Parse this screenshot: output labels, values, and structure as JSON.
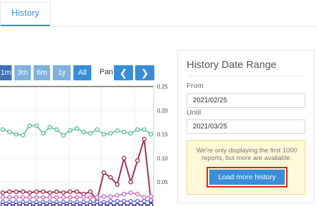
{
  "tabs": [
    {
      "label": "History"
    }
  ],
  "toolbar": {
    "range_buttons": [
      "1m",
      "3m",
      "6m",
      "1y",
      "All"
    ],
    "pan_label": "Pan",
    "prev_icon": "chevron-left-icon",
    "next_icon": "chevron-right-icon"
  },
  "panel": {
    "title": "History Date Range",
    "from_label": "From",
    "from_value": "2021/02/25",
    "until_label": "Until",
    "until_value": "2021/03/25",
    "notice": "We're only displaying the first 1000 reports, but more are available.",
    "load_more_label": "Load more history"
  },
  "colors": {
    "accent": "#3a8ed8",
    "highlight_border": "#e0201a",
    "series_green": "#5fbf9b",
    "series_maroon": "#9b2f5b"
  },
  "chart_data": {
    "type": "line",
    "yticks": [
      "0.25",
      "0.20",
      "0.15",
      "0.10",
      "0.05"
    ],
    "ylim": [
      0,
      0.25
    ],
    "grid": true,
    "series": [
      {
        "color": "#5fbf9b",
        "values": [
          0.16,
          0.155,
          0.15,
          0.148,
          0.168,
          0.168,
          0.152,
          0.165,
          0.16,
          0.148,
          0.158,
          0.162,
          0.155,
          0.152,
          0.16,
          0.15,
          0.152,
          0.158,
          0.155,
          0.152,
          0.16,
          0.16,
          0.15
        ]
      },
      {
        "color": "#9b2f5b",
        "values": [
          0.028,
          0.03,
          0.03,
          0.03,
          0.028,
          0.03,
          0.03,
          0.028,
          0.03,
          0.028,
          0.03,
          0.03,
          0.025,
          0.03,
          0.012,
          0.07,
          0.06,
          0.045,
          0.1,
          0.05,
          0.095,
          0.14,
          0.01
        ]
      },
      {
        "color": "#c873c0",
        "values": [
          0.018,
          0.018,
          0.018,
          0.018,
          0.018,
          0.018,
          0.018,
          0.018,
          0.018,
          0.018,
          0.018,
          0.018,
          0.018,
          0.018,
          0.018,
          0.02,
          0.02,
          0.022,
          0.025,
          0.028,
          0.025,
          0.018,
          0.02
        ]
      },
      {
        "color": "#6b6bd6",
        "values": [
          0.008,
          0.008,
          0.008,
          0.008,
          0.008,
          0.008,
          0.008,
          0.008,
          0.008,
          0.008,
          0.008,
          0.008,
          0.008,
          0.008,
          0.008,
          0.008,
          0.01,
          0.01,
          0.01,
          0.01,
          0.01,
          0.01,
          0.012
        ]
      },
      {
        "color": "#2a2a8a",
        "values": [
          0.002,
          0.002,
          0.002,
          0.002,
          0.002,
          0.002,
          0.002,
          0.002,
          0.002,
          0.002,
          0.002,
          0.002,
          0.002,
          0.002,
          0.002,
          0.002,
          0.002,
          0.002,
          0.002,
          0.002,
          0.002,
          0.002,
          0.002
        ]
      }
    ]
  }
}
